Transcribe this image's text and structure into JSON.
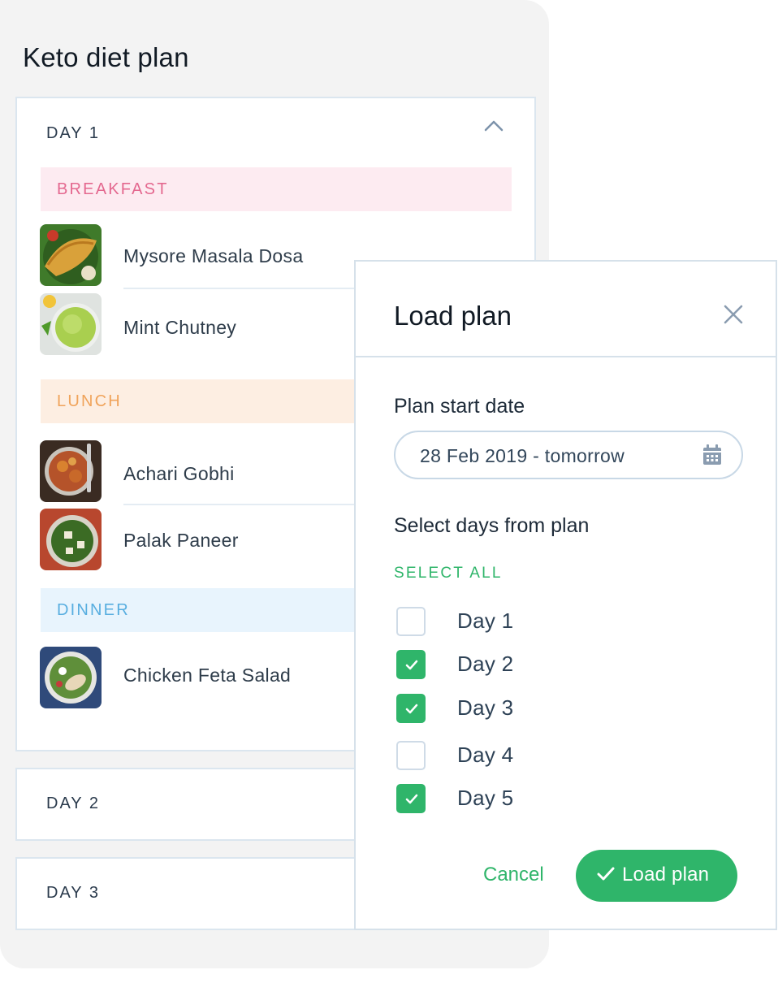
{
  "plan": {
    "title": "Keto diet plan",
    "days": [
      {
        "label": "DAY 1",
        "expanded": true,
        "meals": [
          {
            "name": "BREAKFAST",
            "color": "#e4688f",
            "items": [
              "Mysore Masala Dosa",
              "Mint Chutney"
            ]
          },
          {
            "name": "LUNCH",
            "color": "#f0a35a",
            "items": [
              "Achari Gobhi",
              "Palak Paneer"
            ]
          },
          {
            "name": "DINNER",
            "color": "#58aee0",
            "items": [
              "Chicken Feta Salad"
            ]
          }
        ]
      },
      {
        "label": "DAY 2",
        "expanded": false
      },
      {
        "label": "DAY 3",
        "expanded": false
      }
    ]
  },
  "modal": {
    "title": "Load plan",
    "start_date_label": "Plan start date",
    "start_date_value": "28 Feb 2019 - tomorrow",
    "select_days_label": "Select days from plan",
    "select_all": "SELECT ALL",
    "day_options": [
      {
        "label": "Day 1",
        "checked": false
      },
      {
        "label": "Day 2",
        "checked": true
      },
      {
        "label": "Day 3",
        "checked": true
      },
      {
        "label": "Day 4",
        "checked": false
      },
      {
        "label": "Day 5",
        "checked": true
      }
    ],
    "cancel_label": "Cancel",
    "confirm_label": "Load plan"
  },
  "colors": {
    "accent_green": "#2fb56a",
    "background": "#f3f3f3",
    "border": "#dbe6ef"
  },
  "icons": [
    "chevron-up-icon",
    "close-icon",
    "calendar-icon",
    "check-icon"
  ]
}
